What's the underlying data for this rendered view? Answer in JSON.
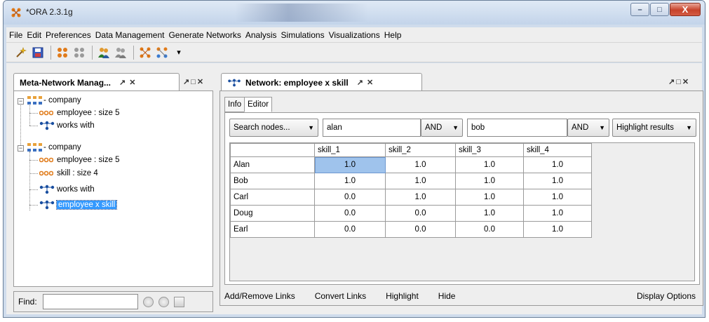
{
  "window": {
    "title": "*ORA 2.3.1g",
    "minimize_glyph": "–",
    "maximize_glyph": "□",
    "close_glyph": "X"
  },
  "menubar": {
    "items": [
      "File",
      "Edit",
      "Preferences",
      "Data Management",
      "Generate Networks",
      "Analysis",
      "Simulations",
      "Visualizations",
      "Help"
    ]
  },
  "toolbar": {
    "icons": [
      "wand-icon",
      "save-icon",
      "node-set-icon",
      "node-set-gray-icon",
      "agents-icon",
      "agents-gray-icon",
      "network-icon",
      "network-dropdown-icon"
    ],
    "overflow_glyph": "▾"
  },
  "left_dock": {
    "tab_label": "Meta-Network Manag...",
    "pin_glyph": "↗",
    "close_glyph": "✕",
    "dock_ctrls": "↗□✕",
    "tree": [
      {
        "label": "- company",
        "kind": "meta"
      },
      {
        "label": "employee : size 5",
        "kind": "nodeset"
      },
      {
        "label": "works with",
        "kind": "network"
      },
      {
        "label": "- company",
        "kind": "meta"
      },
      {
        "label": "employee : size 5",
        "kind": "nodeset"
      },
      {
        "label": "skill : size 4",
        "kind": "nodeset"
      },
      {
        "label": "works with",
        "kind": "network"
      },
      {
        "label": "employee x skill",
        "kind": "network",
        "selected": true
      }
    ],
    "find_label": "Find:",
    "find_value": ""
  },
  "right_dock": {
    "tab_label": "Network: employee x skill",
    "pin_glyph": "↗",
    "close_glyph": "✕",
    "dock_ctrls": "↗□✕",
    "subtabs": [
      "Info",
      "Editor"
    ],
    "active_subtab": "Editor",
    "search": {
      "mode": "Search nodes...",
      "term1": "alan",
      "op1": "AND",
      "term2": "bob",
      "op2": "AND",
      "action": "Highlight results"
    },
    "matrix": {
      "columns": [
        "skill_1",
        "skill_2",
        "skill_3",
        "skill_4"
      ],
      "rows": [
        {
          "name": "Alan",
          "values": [
            "1.0",
            "1.0",
            "1.0",
            "1.0"
          ]
        },
        {
          "name": "Bob",
          "values": [
            "1.0",
            "1.0",
            "1.0",
            "1.0"
          ]
        },
        {
          "name": "Carl",
          "values": [
            "0.0",
            "1.0",
            "1.0",
            "1.0"
          ]
        },
        {
          "name": "Doug",
          "values": [
            "0.0",
            "0.0",
            "1.0",
            "1.0"
          ]
        },
        {
          "name": "Earl",
          "values": [
            "0.0",
            "0.0",
            "0.0",
            "1.0"
          ]
        }
      ],
      "selected_cell": {
        "row": 0,
        "col": 0
      }
    },
    "bottom_buttons": [
      "Add/Remove Links",
      "Convert Links",
      "Highlight",
      "Hide"
    ],
    "display_options": "Display Options"
  },
  "colors": {
    "selection": "#3399ff",
    "selected_cell": "#9fc3ec",
    "nodeset_icon": "#e07b1a",
    "network_icon": "#1a4fa0",
    "meta_icon": "#e8a13a"
  }
}
